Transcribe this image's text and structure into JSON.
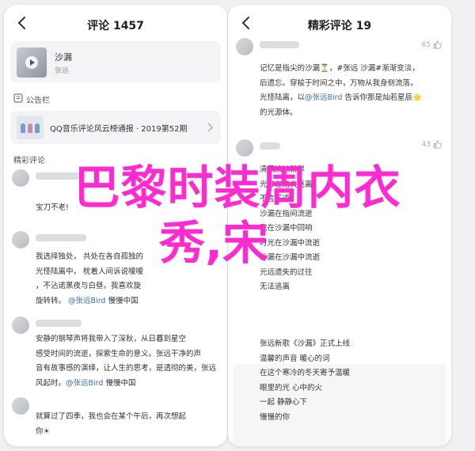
{
  "left": {
    "title": "评论 1457",
    "album": {
      "name": "沙漏",
      "artist": "张远"
    },
    "notice_section": "公告栏",
    "notice_text": "QQ音乐评论风云榜通报 · 2019第52期",
    "featured_section": "精彩评论",
    "c1": {
      "lines": [
        "宝刀不老!"
      ]
    },
    "c2": {
      "lines": [
        "我选择独处， 共处在各自孤独的",
        "光怪陆离中， 枕着人间诉说嗳嗳",
        "，不沾诺黑夜与白昼。我喜欢旋",
        "旋转转。 @张远Bird 慢慢中国"
      ],
      "mention": "@张远Bird"
    },
    "c3": {
      "lines": [
        "安静的钢琴声将我带入了深秋，从日暮到星空",
        "感受时间的流逝，探索生命的意义。张远干净的声",
        "音有故事感的演绎，让人生的思考，是透彻的美，张远",
        "风起时。@张远Bird 慢慢中国"
      ]
    },
    "c4": {
      "lines": [
        "就算过了四季，我也会在某个午后，再次想起",
        "你☀"
      ]
    }
  },
  "right": {
    "title": "精彩评论 19",
    "c1": {
      "likes": "65",
      "lines": [
        "记忆是指尖的沙漏⏳，#张远 沙漏#渐渐变淡，",
        "后遗忘。穿梭于时间之中，万物从我身侧流落，",
        "光怪陆离，以@张远Bird 告诉你那是灿若星辰🌟",
        "的光源体。"
      ]
    },
    "c2": {
      "likes": "43",
      "lines": [
        "清风拂过耕犁",
        "光影在指尖迷离",
        "不言不语",
        "沙漏在指间流逝",
        "我在沙漏中回响",
        "时光在沙漏中流逝",
        "沙漏在沙漏中流逝",
        "元远遗失的过往",
        "无法逃离"
      ]
    },
    "c3": {
      "lines": [
        "张远新歌《沙漏》正式上线",
        "温馨的声音 暖心的词",
        "在这个寒冷的冬天寄予温暖",
        "眼里的光 心中的火",
        "一起 静静心下",
        "慢慢的你"
      ]
    }
  },
  "overlay": {
    "line1": "巴黎时装周内衣",
    "line2": "秀,宋"
  }
}
